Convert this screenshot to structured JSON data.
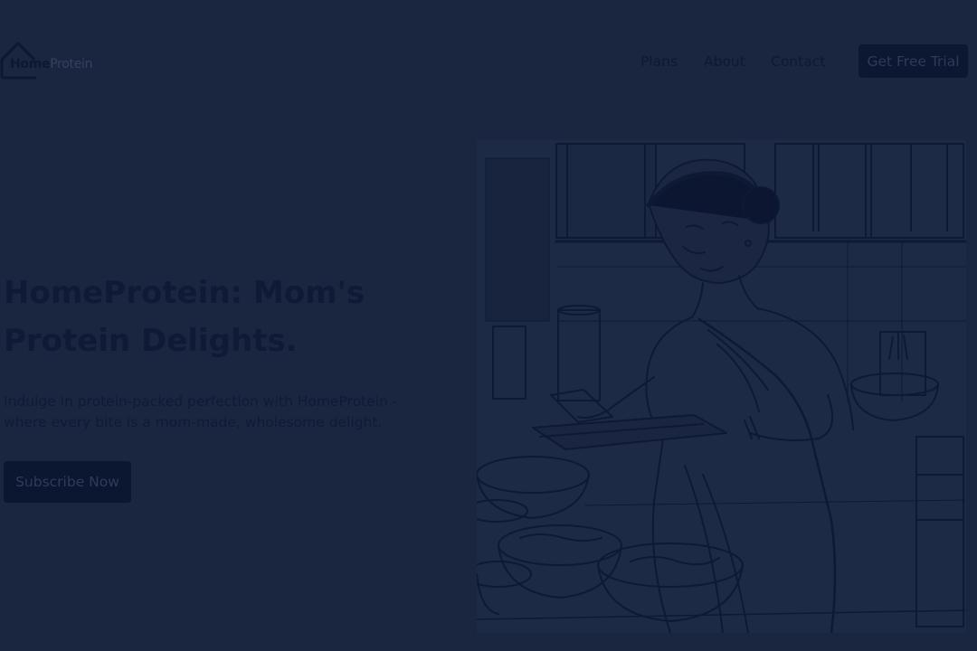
{
  "header": {
    "logo": {
      "brand_home": "Home",
      "brand_protein": "Protein",
      "icon": "house-outline-icon"
    },
    "nav": {
      "plans": "Plans",
      "about": "About",
      "contact": "Contact"
    },
    "cta_label": "Get Free Trial"
  },
  "hero": {
    "title": "HomeProtein: Mom's Protein Delights.",
    "subtitle": "Indulge in protein-packed perfection with HomeProtein - where every bite is a mom-made, wholesome delight.",
    "button_label": "Subscribe Now",
    "illustration": "sketch of a woman cooking in a kitchen with bowls"
  },
  "colors": {
    "background": "#1a2640",
    "text_dark": "#0f1a36",
    "button_bg": "#0c1731",
    "button_text": "#2d3a58"
  }
}
